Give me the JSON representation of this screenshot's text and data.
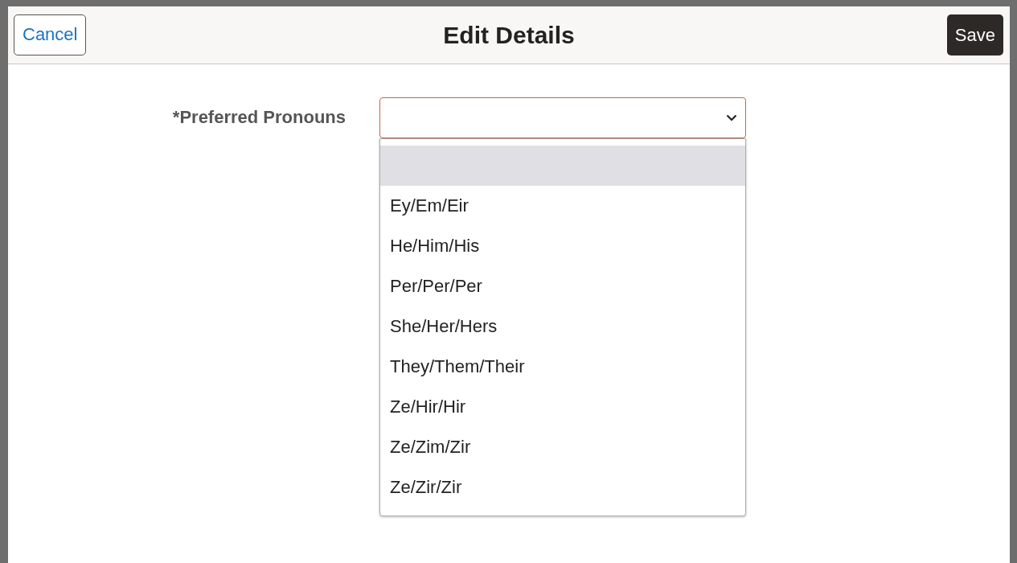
{
  "dialog": {
    "title": "Edit Details",
    "cancel_button": "Cancel",
    "save_button": "Save"
  },
  "field": {
    "label": "*Preferred Pronouns",
    "expanded": true,
    "options": [
      {
        "kind": "blank",
        "selected": true
      },
      {
        "kind": "text",
        "label": "Ey/Em/Eir",
        "selected": false
      },
      {
        "kind": "text",
        "label": "He/Him/His",
        "selected": false
      },
      {
        "kind": "text",
        "label": "Per/Per/Per",
        "selected": false
      },
      {
        "kind": "text",
        "label": "She/Her/Hers",
        "selected": false
      },
      {
        "kind": "text",
        "label": "They/Them/Their",
        "selected": false
      },
      {
        "kind": "text",
        "label": "Ze/Hir/Hir",
        "selected": false
      },
      {
        "kind": "text",
        "label": "Ze/Zim/Zir",
        "selected": false
      },
      {
        "kind": "text",
        "label": "Ze/Zir/Zir",
        "selected": false
      }
    ]
  }
}
